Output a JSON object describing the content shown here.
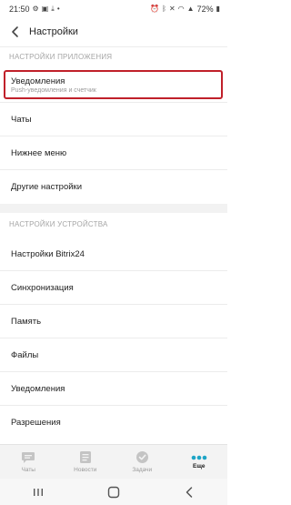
{
  "status_bar": {
    "time": "21:50",
    "battery": "72%"
  },
  "header": {
    "title": "Настройки"
  },
  "sections": [
    {
      "label": "НАСТРОЙКИ ПРИЛОЖЕНИЯ",
      "items": [
        {
          "title": "Уведомления",
          "subtitle": "Push-уведомления и счетчик"
        },
        {
          "title": "Чаты"
        },
        {
          "title": "Нижнее меню"
        },
        {
          "title": "Другие настройки"
        }
      ]
    },
    {
      "label": "НАСТРОЙКИ УСТРОЙСТВА",
      "items": [
        {
          "title": "Настройки Bitrix24"
        },
        {
          "title": "Синхронизация"
        },
        {
          "title": "Память"
        },
        {
          "title": "Файлы"
        },
        {
          "title": "Уведомления"
        },
        {
          "title": "Разрешения"
        }
      ]
    }
  ],
  "bottom_nav": [
    {
      "label": "Чаты",
      "icon": "chat-icon"
    },
    {
      "label": "Новости",
      "icon": "news-icon"
    },
    {
      "label": "Задачи",
      "icon": "tasks-icon"
    },
    {
      "label": "Еще",
      "icon": "more-icon"
    }
  ],
  "colors": {
    "accent": "#1ea5c6",
    "highlight_border": "#c0202a"
  }
}
